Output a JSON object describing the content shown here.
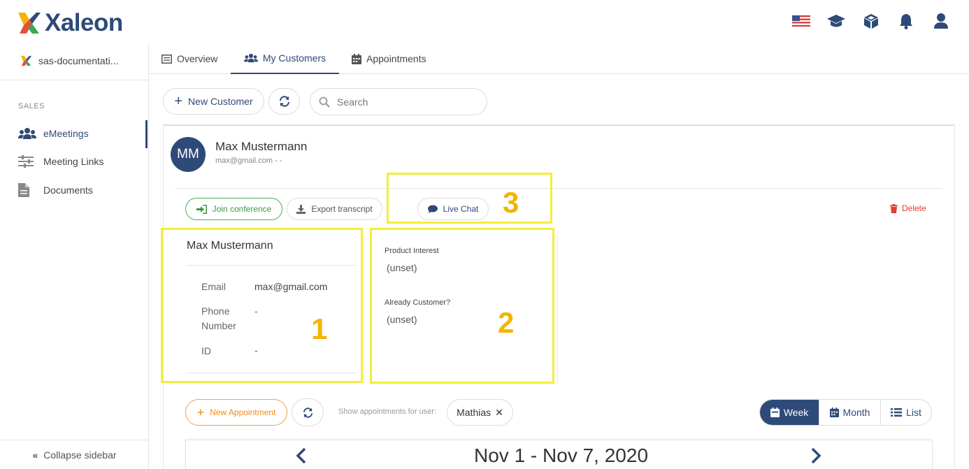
{
  "brand": {
    "name": "Xaleon",
    "accent": "#2e4a78"
  },
  "top_icons": [
    "us-flag-icon",
    "graduation-cap-icon",
    "cube-icon",
    "bell-icon",
    "user-icon"
  ],
  "sidebar": {
    "org": "sas-documentati...",
    "section": "SALES",
    "items": [
      {
        "label": "eMeetings",
        "icon": "users-icon",
        "active": true
      },
      {
        "label": "Meeting Links",
        "icon": "sliders-icon",
        "active": false
      },
      {
        "label": "Documents",
        "icon": "document-icon",
        "active": false
      }
    ],
    "collapse": "Collapse sidebar"
  },
  "tabs": [
    {
      "label": "Overview",
      "icon": "list-icon",
      "active": false
    },
    {
      "label": "My Customers",
      "icon": "users-icon",
      "active": true
    },
    {
      "label": "Appointments",
      "icon": "calendar-icon",
      "active": false
    }
  ],
  "toolbar": {
    "new_customer": "New Customer",
    "search_placeholder": "Search"
  },
  "customer": {
    "initials": "MM",
    "name": "Max Mustermann",
    "subtitle": "max@gmail.com - -",
    "actions": {
      "join": "Join conference",
      "export": "Export transcript",
      "chat": "Live Chat",
      "delete": "Delete"
    },
    "details": {
      "title": "Max Mustermann",
      "email_label": "Email",
      "email_value": "max@gmail.com",
      "phone_label_1": "Phone",
      "phone_label_2": "Number",
      "phone_value": "-",
      "id_label": "ID",
      "id_value": "-"
    },
    "fields": {
      "product_interest_label": "Product Interest",
      "product_interest_value": "(unset)",
      "already_customer_label": "Already Customer?",
      "already_customer_value": "(unset)"
    }
  },
  "annotations": {
    "one": "1",
    "two": "2",
    "three": "3",
    "highlight_color": "#f1ee3a",
    "number_color": "#f4b400"
  },
  "appointments": {
    "new": "New Appointment",
    "show_for": "Show appointments for user:",
    "user_chip": "Mathias",
    "views": {
      "week": "Week",
      "month": "Month",
      "list": "List"
    },
    "selected_view": "Week",
    "range": "Nov 1 - Nov 7, 2020"
  }
}
